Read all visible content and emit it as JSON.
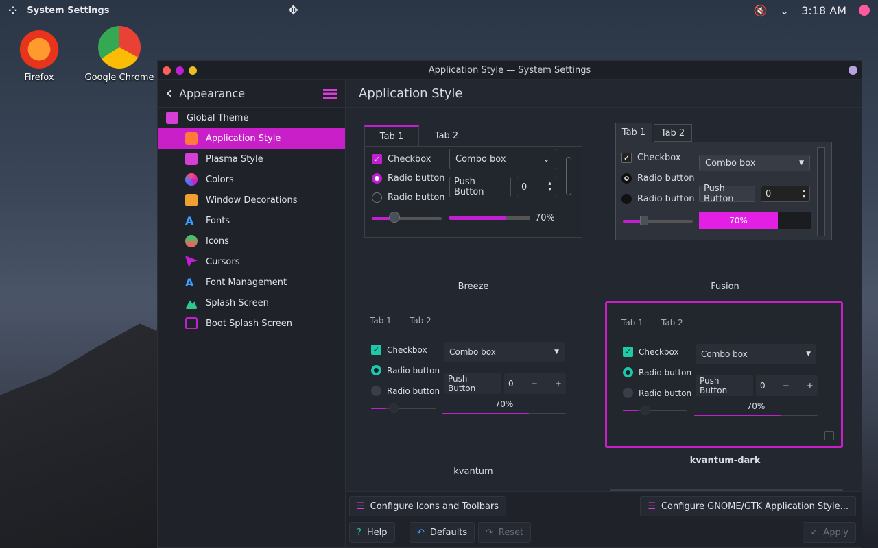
{
  "topbar": {
    "app": "System Settings",
    "time": "3:18 AM"
  },
  "desktop": [
    {
      "label": "Firefox"
    },
    {
      "label": "Google Chrome"
    }
  ],
  "window": {
    "title": "Application Style — System Settings"
  },
  "sidebar": {
    "back_title": "Appearance",
    "items": [
      {
        "label": "Global Theme"
      },
      {
        "label": "Application Style"
      },
      {
        "label": "Plasma Style"
      },
      {
        "label": "Colors"
      },
      {
        "label": "Window Decorations"
      },
      {
        "label": "Fonts"
      },
      {
        "label": "Icons"
      },
      {
        "label": "Cursors"
      },
      {
        "label": "Font Management"
      },
      {
        "label": "Splash Screen"
      },
      {
        "label": "Boot Splash Screen"
      }
    ]
  },
  "main": {
    "title": "Application Style"
  },
  "styles": [
    {
      "name": "Breeze"
    },
    {
      "name": "Fusion"
    },
    {
      "name": "kvantum"
    },
    {
      "name": "kvantum-dark"
    }
  ],
  "widgets": {
    "tab1": "Tab 1",
    "tab2": "Tab 2",
    "checkbox": "Checkbox",
    "radio": "Radio button",
    "combo": "Combo box",
    "push": "Push Button",
    "spin": "0",
    "progress": "70%",
    "progress_value": 0.7
  },
  "footer": {
    "configure_icons": "Configure Icons and Toolbars",
    "configure_gtk": "Configure GNOME/GTK Application Style...",
    "help": "Help",
    "defaults": "Defaults",
    "reset": "Reset",
    "apply": "Apply"
  },
  "colors": {
    "accent": "#c81fc8",
    "teal": "#1ec9a6"
  }
}
